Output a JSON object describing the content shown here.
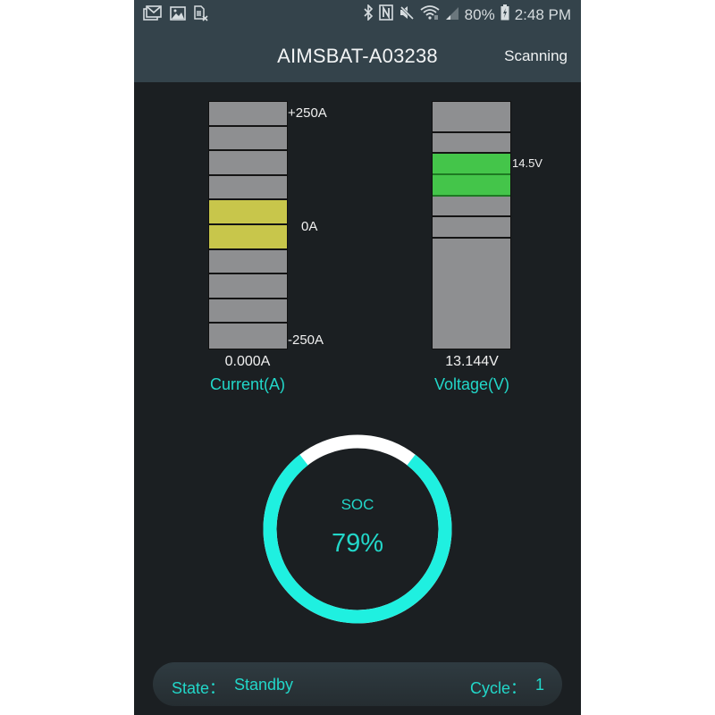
{
  "status_bar": {
    "left_icons": [
      "gmail-icon",
      "gallery-icon",
      "sim-card-off-icon"
    ],
    "right_icons": [
      "bluetooth-icon",
      "nfc-icon",
      "mute-icon",
      "wifi-icon",
      "signal-icon"
    ],
    "battery_percent": "80%",
    "battery_icon": "battery-charging-icon",
    "time": "2:48 PM"
  },
  "app_bar": {
    "title": "AIMSBAT-A03238",
    "action": "Scanning"
  },
  "current_gauge": {
    "top_label": "+250A",
    "mid_label": "0A",
    "bottom_label": "-250A",
    "value": "0.000A",
    "name": "Current(A)",
    "segments": 10,
    "active_segments": [
      4,
      5
    ],
    "active_color": "#c8c64b",
    "inactive_color": "#8e8f91"
  },
  "voltage_gauge": {
    "marker_label": "14.5V",
    "value": "13.144V",
    "name": "Voltage(V)",
    "segment_fractions": [
      0.127,
      0.083,
      0.087,
      0.087,
      0.083,
      0.087,
      0.446
    ],
    "active_segments": [
      2,
      3
    ],
    "active_color": "#44c54a",
    "inactive_color": "#8e8f91"
  },
  "soc": {
    "label": "SOC",
    "value": "79%",
    "percent": 79,
    "fill_color": "#1ff0e0",
    "track_color": "#ffffff"
  },
  "status": {
    "state_label": "State：",
    "state_value": "Standby",
    "cycle_label": "Cycle：",
    "cycle_value": "1"
  }
}
